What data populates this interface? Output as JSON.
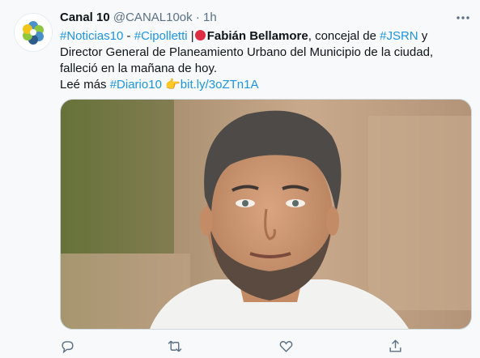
{
  "tweet": {
    "author": {
      "name": "Canal 10",
      "handle": "@CANAL10ok",
      "separator": "·",
      "time": "1h",
      "avatar_icon": "canal10-logo-icon"
    },
    "text": {
      "hashtag_noticias": "#Noticias10",
      "dash": " - ",
      "hashtag_cipolletti": "#Cipolletti",
      "pipe": " |",
      "red_circle_icon": "red-circle-emoji",
      "person_name": "Fabián Bellamore",
      "body_part1": ", concejal de ",
      "hashtag_jsrn": "#JSRN",
      "body_part2": " y Director General de Planeamiento Urbano del Municipio de la ciudad, falleció en la mañana de hoy.",
      "read_more": "Leé más ",
      "hashtag_diario": "#Diario10",
      "finger_icon": "backhand-index-pointing-right-emoji",
      "finger_glyph": "👉",
      "link": "bit.ly/3oZTn1A"
    },
    "media": {
      "type": "photo",
      "icon": "portrait-photo"
    },
    "actions": [
      {
        "name": "reply-icon"
      },
      {
        "name": "retweet-icon"
      },
      {
        "name": "like-icon"
      },
      {
        "name": "share-icon"
      }
    ],
    "colors": {
      "link": "#1b95e0",
      "text": "#0f1419",
      "meta": "#5b7083",
      "background": "#f7f9fa"
    }
  }
}
